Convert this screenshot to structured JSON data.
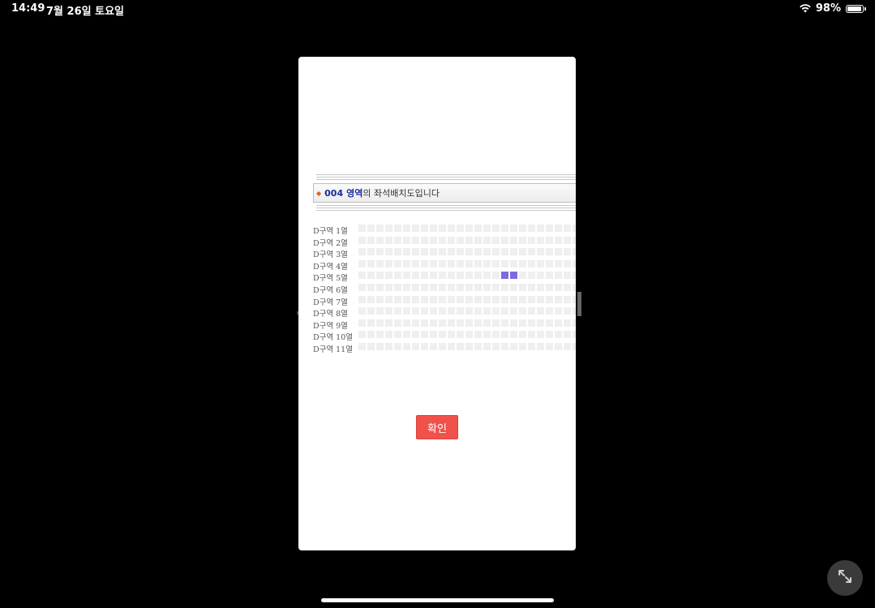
{
  "status_bar": {
    "time": "14:49",
    "date": "7월 26일 토요일",
    "battery": "98%",
    "battery_level": 0.98
  },
  "banner": {
    "area_code": "004",
    "area_word": "영역",
    "suffix": "의 좌석배치도입니다"
  },
  "seat_map": {
    "rows": [
      {
        "label": "D구역 1열",
        "available_seats": []
      },
      {
        "label": "D구역 2열",
        "available_seats": []
      },
      {
        "label": "D구역 3열",
        "available_seats": []
      },
      {
        "label": "D구역 4열",
        "available_seats": []
      },
      {
        "label": "D구역 5열",
        "available_seats": [
          16,
          17
        ]
      },
      {
        "label": "D구역 6열",
        "available_seats": []
      },
      {
        "label": "D구역 7열",
        "available_seats": []
      },
      {
        "label": "D구역 8열",
        "available_seats": []
      },
      {
        "label": "D구역 9열",
        "available_seats": []
      },
      {
        "label": "D구역 10열",
        "available_seats": []
      },
      {
        "label": "D구역 11열",
        "available_seats": []
      }
    ],
    "seats_per_row": 25,
    "colors": {
      "unavailable": "#efefef",
      "available": "#7b6ae0"
    }
  },
  "confirm_label": "확인",
  "colors": {
    "confirm_button": "#f0514a",
    "area_text": "#1a2a9c"
  }
}
